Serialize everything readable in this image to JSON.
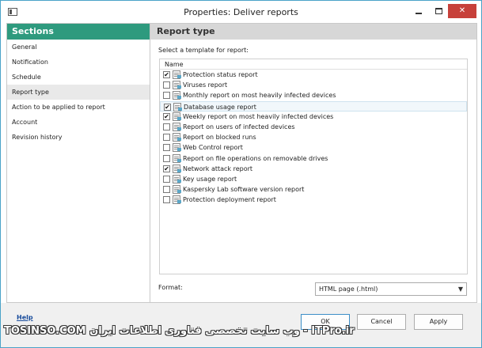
{
  "window": {
    "title": "Properties: Deliver reports",
    "close_glyph": "✕"
  },
  "sidebar": {
    "header": "Sections",
    "items": [
      {
        "label": "General",
        "selected": false
      },
      {
        "label": "Notification",
        "selected": false
      },
      {
        "label": "Schedule",
        "selected": false
      },
      {
        "label": "Report type",
        "selected": true
      },
      {
        "label": "Action to be applied to report",
        "selected": false
      },
      {
        "label": "Account",
        "selected": false
      },
      {
        "label": "Revision history",
        "selected": false
      }
    ]
  },
  "main": {
    "header": "Report type",
    "prompt": "Select a template for report:",
    "list_column": "Name",
    "reports": [
      {
        "label": "Protection status report",
        "checked": true
      },
      {
        "label": "Viruses report",
        "checked": false
      },
      {
        "label": "Monthly report on most heavily infected devices",
        "checked": false
      },
      {
        "label": "Database usage report",
        "checked": true
      },
      {
        "label": "Weekly report on most heavily infected devices",
        "checked": true
      },
      {
        "label": "Report on users of infected devices",
        "checked": false
      },
      {
        "label": "Report on blocked runs",
        "checked": false
      },
      {
        "label": "Web Control report",
        "checked": false
      },
      {
        "label": "Report on file operations on removable drives",
        "checked": false
      },
      {
        "label": "Network attack report",
        "checked": true
      },
      {
        "label": "Key usage report",
        "checked": false
      },
      {
        "label": "Kaspersky Lab software version report",
        "checked": false
      },
      {
        "label": "Protection deployment report",
        "checked": false
      }
    ],
    "highlighted_row": 3,
    "format_label": "Format:",
    "format_value": "HTML page (.html)"
  },
  "footer": {
    "help": "Help",
    "ok": "OK",
    "cancel": "Cancel",
    "apply": "Apply",
    "watermark": "TOSINSO.COM وب سایت تخصصی فناوری اطلاعات ایران - ITPro.ir"
  },
  "colors": {
    "sections_header": "#2e9a7e",
    "close_button": "#c7403a",
    "link": "#1a4d9c"
  },
  "icons": [
    "app-icon",
    "minimize-icon",
    "maximize-icon",
    "close-icon",
    "report-template-icon",
    "dropdown-arrow-icon"
  ]
}
